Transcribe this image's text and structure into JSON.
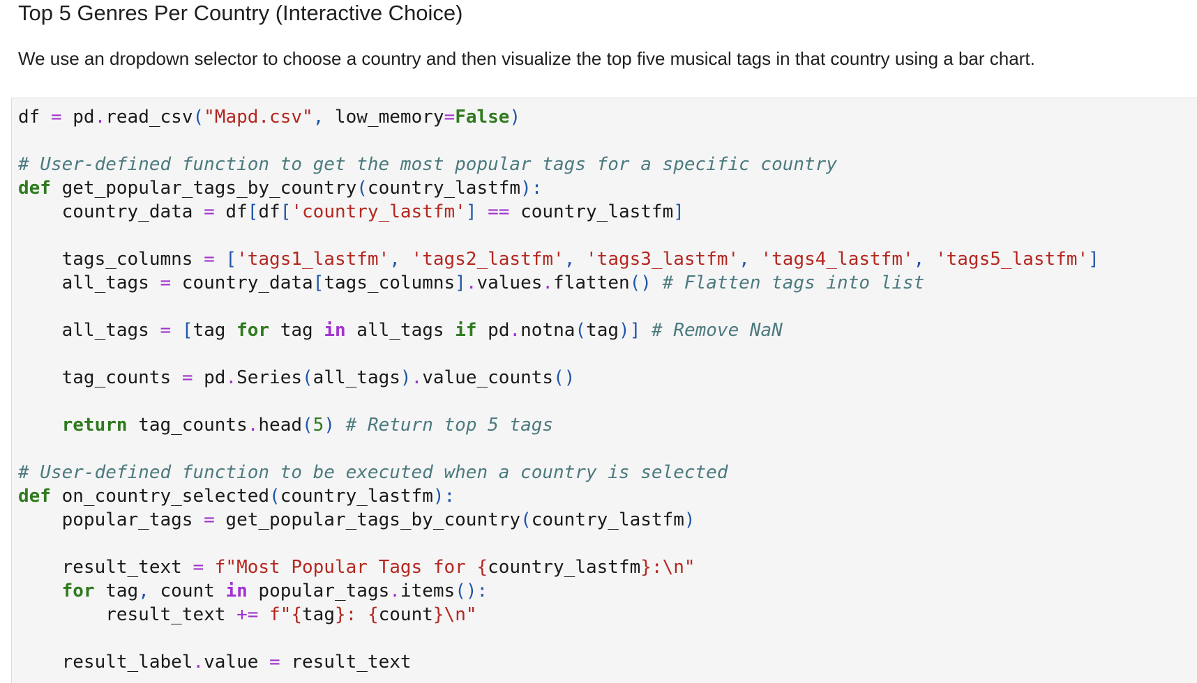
{
  "page": {
    "heading": "Top 5 Genres Per Country (Interactive Choice)",
    "description": "We use an dropdown selector to choose a country and then visualize the top five musical tags in that country using a bar chart."
  },
  "colors": {
    "cell_background": "#f5f5f5",
    "keyword": "#2f7a1e",
    "operator": "#a231cf",
    "string": "#b42720",
    "comment": "#4c7a7f",
    "number": "#2f7a1e",
    "punctuation": "#1f56a8"
  },
  "code_cell": {
    "lines": [
      [
        {
          "t": "df "
        },
        {
          "t": "=",
          "c": "t-op"
        },
        {
          "t": " pd"
        },
        {
          "t": ".",
          "c": "t-op"
        },
        {
          "t": "read_csv"
        },
        {
          "t": "(",
          "c": "t-punc"
        },
        {
          "t": "\"Mapd.csv\"",
          "c": "t-str"
        },
        {
          "t": ",",
          "c": "t-punc"
        },
        {
          "t": " low_memory"
        },
        {
          "t": "=",
          "c": "t-op"
        },
        {
          "t": "False",
          "c": "t-kw"
        },
        {
          "t": ")",
          "c": "t-punc"
        }
      ],
      [],
      [
        {
          "t": "# User-defined function to get the most popular tags for a specific country",
          "c": "t-com"
        }
      ],
      [
        {
          "t": "def",
          "c": "t-kw"
        },
        {
          "t": " get_popular_tags_by_country"
        },
        {
          "t": "(",
          "c": "t-punc"
        },
        {
          "t": "country_lastfm"
        },
        {
          "t": "):",
          "c": "t-punc"
        }
      ],
      [
        {
          "t": "    country_data "
        },
        {
          "t": "=",
          "c": "t-op"
        },
        {
          "t": " df"
        },
        {
          "t": "[",
          "c": "t-punc"
        },
        {
          "t": "df"
        },
        {
          "t": "[",
          "c": "t-punc"
        },
        {
          "t": "'country_lastfm'",
          "c": "t-str"
        },
        {
          "t": "]",
          "c": "t-punc"
        },
        {
          "t": " "
        },
        {
          "t": "==",
          "c": "t-op"
        },
        {
          "t": " country_lastfm"
        },
        {
          "t": "]",
          "c": "t-punc"
        }
      ],
      [],
      [
        {
          "t": "    tags_columns "
        },
        {
          "t": "=",
          "c": "t-op"
        },
        {
          "t": " "
        },
        {
          "t": "[",
          "c": "t-punc"
        },
        {
          "t": "'tags1_lastfm'",
          "c": "t-str"
        },
        {
          "t": ",",
          "c": "t-punc"
        },
        {
          "t": " "
        },
        {
          "t": "'tags2_lastfm'",
          "c": "t-str"
        },
        {
          "t": ",",
          "c": "t-punc"
        },
        {
          "t": " "
        },
        {
          "t": "'tags3_lastfm'",
          "c": "t-str"
        },
        {
          "t": ",",
          "c": "t-punc"
        },
        {
          "t": " "
        },
        {
          "t": "'tags4_lastfm'",
          "c": "t-str"
        },
        {
          "t": ",",
          "c": "t-punc"
        },
        {
          "t": " "
        },
        {
          "t": "'tags5_lastfm'",
          "c": "t-str"
        },
        {
          "t": "]",
          "c": "t-punc"
        }
      ],
      [
        {
          "t": "    all_tags "
        },
        {
          "t": "=",
          "c": "t-op"
        },
        {
          "t": " country_data"
        },
        {
          "t": "[",
          "c": "t-punc"
        },
        {
          "t": "tags_columns"
        },
        {
          "t": "]",
          "c": "t-punc"
        },
        {
          "t": ".",
          "c": "t-op"
        },
        {
          "t": "values"
        },
        {
          "t": ".",
          "c": "t-op"
        },
        {
          "t": "flatten"
        },
        {
          "t": "()",
          "c": "t-punc"
        },
        {
          "t": " "
        },
        {
          "t": "# Flatten tags into list",
          "c": "t-com"
        }
      ],
      [],
      [
        {
          "t": "    all_tags "
        },
        {
          "t": "=",
          "c": "t-op"
        },
        {
          "t": " "
        },
        {
          "t": "[",
          "c": "t-punc"
        },
        {
          "t": "tag "
        },
        {
          "t": "for",
          "c": "t-kw"
        },
        {
          "t": " tag "
        },
        {
          "t": "in",
          "c": "t-opk"
        },
        {
          "t": " all_tags "
        },
        {
          "t": "if",
          "c": "t-kw"
        },
        {
          "t": " pd"
        },
        {
          "t": ".",
          "c": "t-op"
        },
        {
          "t": "notna"
        },
        {
          "t": "(",
          "c": "t-punc"
        },
        {
          "t": "tag"
        },
        {
          "t": ")]",
          "c": "t-punc"
        },
        {
          "t": " "
        },
        {
          "t": "# Remove NaN",
          "c": "t-com"
        }
      ],
      [],
      [
        {
          "t": "    tag_counts "
        },
        {
          "t": "=",
          "c": "t-op"
        },
        {
          "t": " pd"
        },
        {
          "t": ".",
          "c": "t-op"
        },
        {
          "t": "Series"
        },
        {
          "t": "(",
          "c": "t-punc"
        },
        {
          "t": "all_tags"
        },
        {
          "t": ")",
          "c": "t-punc"
        },
        {
          "t": ".",
          "c": "t-op"
        },
        {
          "t": "value_counts"
        },
        {
          "t": "()",
          "c": "t-punc"
        }
      ],
      [],
      [
        {
          "t": "    "
        },
        {
          "t": "return",
          "c": "t-kw"
        },
        {
          "t": " tag_counts"
        },
        {
          "t": ".",
          "c": "t-op"
        },
        {
          "t": "head"
        },
        {
          "t": "(",
          "c": "t-punc"
        },
        {
          "t": "5",
          "c": "t-num"
        },
        {
          "t": ")",
          "c": "t-punc"
        },
        {
          "t": " "
        },
        {
          "t": "# Return top 5 tags",
          "c": "t-com"
        }
      ],
      [],
      [
        {
          "t": "# User-defined function to be executed when a country is selected",
          "c": "t-com"
        }
      ],
      [
        {
          "t": "def",
          "c": "t-kw"
        },
        {
          "t": " on_country_selected"
        },
        {
          "t": "(",
          "c": "t-punc"
        },
        {
          "t": "country_lastfm"
        },
        {
          "t": "):",
          "c": "t-punc"
        }
      ],
      [
        {
          "t": "    popular_tags "
        },
        {
          "t": "=",
          "c": "t-op"
        },
        {
          "t": " get_popular_tags_by_country"
        },
        {
          "t": "(",
          "c": "t-punc"
        },
        {
          "t": "country_lastfm"
        },
        {
          "t": ")",
          "c": "t-punc"
        }
      ],
      [],
      [
        {
          "t": "    result_text "
        },
        {
          "t": "=",
          "c": "t-op"
        },
        {
          "t": " "
        },
        {
          "t": "f\"Most Popular Tags for ",
          "c": "t-str"
        },
        {
          "t": "{",
          "c": "t-str"
        },
        {
          "t": "country_lastfm"
        },
        {
          "t": "}",
          "c": "t-str"
        },
        {
          "t": ":\\n\"",
          "c": "t-str"
        }
      ],
      [
        {
          "t": "    "
        },
        {
          "t": "for",
          "c": "t-kw"
        },
        {
          "t": " tag"
        },
        {
          "t": ",",
          "c": "t-punc"
        },
        {
          "t": " count "
        },
        {
          "t": "in",
          "c": "t-opk"
        },
        {
          "t": " popular_tags"
        },
        {
          "t": ".",
          "c": "t-op"
        },
        {
          "t": "items"
        },
        {
          "t": "():",
          "c": "t-punc"
        }
      ],
      [
        {
          "t": "        result_text "
        },
        {
          "t": "+=",
          "c": "t-op"
        },
        {
          "t": " "
        },
        {
          "t": "f\"",
          "c": "t-str"
        },
        {
          "t": "{",
          "c": "t-str"
        },
        {
          "t": "tag"
        },
        {
          "t": "}",
          "c": "t-str"
        },
        {
          "t": ": ",
          "c": "t-str"
        },
        {
          "t": "{",
          "c": "t-str"
        },
        {
          "t": "count"
        },
        {
          "t": "}",
          "c": "t-str"
        },
        {
          "t": "\\n\"",
          "c": "t-str"
        }
      ],
      [],
      [
        {
          "t": "    result_label"
        },
        {
          "t": ".",
          "c": "t-op"
        },
        {
          "t": "value "
        },
        {
          "t": "=",
          "c": "t-op"
        },
        {
          "t": " result_text"
        }
      ]
    ]
  }
}
